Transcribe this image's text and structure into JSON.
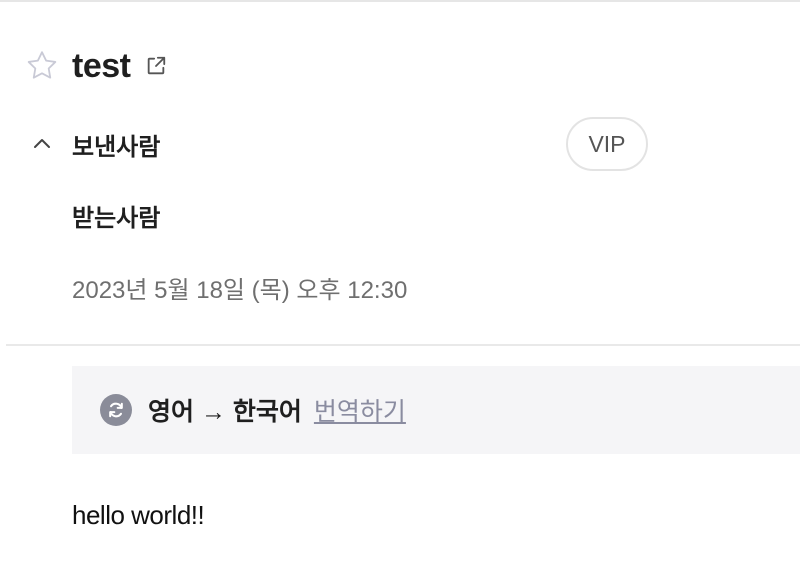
{
  "subject": {
    "title": "test",
    "star_icon": "star-outline-icon",
    "external_icon": "external-link-icon"
  },
  "header": {
    "sender_label": "보낸사람",
    "recipient_label": "받는사람",
    "vip_label": "VIP",
    "date": "2023년 5월 18일 (목) 오후 12:30",
    "collapse_icon": "chevron-up-icon"
  },
  "translation": {
    "icon": "translate-refresh-icon",
    "lang_pair": "영어 → 한국어",
    "action_label": "번역하기"
  },
  "message": {
    "body": "hello world!!"
  },
  "colors": {
    "accent_gray": "#8a8c99",
    "translate_bar_bg": "#f5f5f7",
    "link": "#8a8ca0"
  }
}
